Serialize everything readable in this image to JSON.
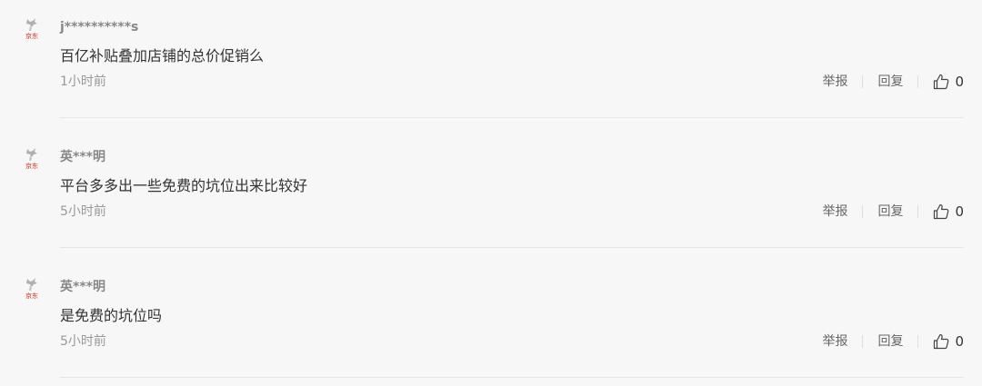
{
  "comments": [
    {
      "avatar_icon": "jd-dog-logo-icon",
      "avatar_text": "京东",
      "username": "j**********s",
      "content": "百亿补贴叠加店铺的总价促销么",
      "time": "1小时前",
      "report_label": "举报",
      "reply_label": "回复",
      "likes": "0"
    },
    {
      "avatar_icon": "jd-dog-logo-icon",
      "avatar_text": "京东",
      "username": "英***明",
      "content": "平台多多出一些免费的坑位出来比较好",
      "time": "5小时前",
      "report_label": "举报",
      "reply_label": "回复",
      "likes": "0"
    },
    {
      "avatar_icon": "jd-dog-logo-icon",
      "avatar_text": "京东",
      "username": "英***明",
      "content": "是免费的坑位吗",
      "time": "5小时前",
      "report_label": "举报",
      "reply_label": "回复",
      "likes": "0"
    }
  ],
  "colors": {
    "background": "#f7f7f7",
    "brand_red": "#e1251b",
    "text_primary": "#333333",
    "text_secondary": "#999999"
  }
}
